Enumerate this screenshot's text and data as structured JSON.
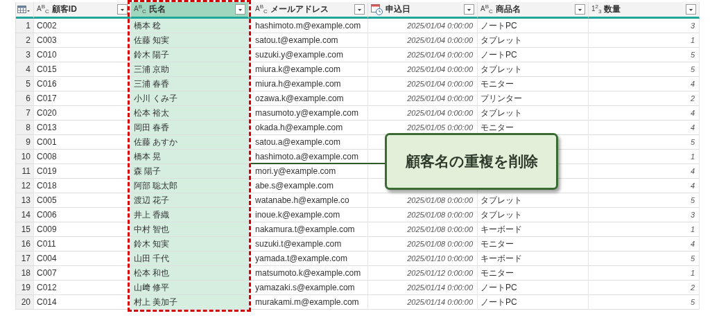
{
  "table": {
    "columns": [
      {
        "label": "顧客ID",
        "kind": "text",
        "type_label": "A$^{B}$$_{C}$",
        "selected": false
      },
      {
        "label": "氏名",
        "kind": "text",
        "type_label": "A$^{B}$$_{C}$",
        "selected": true
      },
      {
        "label": "メールアドレス",
        "kind": "text",
        "type_label": "A$^{B}$$_{C}$",
        "selected": false
      },
      {
        "label": "申込日",
        "kind": "date",
        "selected": false
      },
      {
        "label": "商品名",
        "kind": "text",
        "type_label": "A$^{B}$$_{C}$",
        "selected": false
      },
      {
        "label": "数量",
        "kind": "number",
        "type_label": "1$^{2}$$_{3}$",
        "selected": false
      }
    ],
    "rows": [
      {
        "number": "1",
        "cells": [
          "C002",
          "橋本 稔",
          "hashimoto.m@example.com",
          "2025/01/04 0:00:00",
          "ノートPC",
          "3"
        ]
      },
      {
        "number": "2",
        "cells": [
          "C003",
          "佐藤 知実",
          "satou.t@example.com",
          "2025/01/04 0:00:00",
          "タブレット",
          "1"
        ]
      },
      {
        "number": "3",
        "cells": [
          "C010",
          "鈴木 陽子",
          "suzuki.y@example.com",
          "2025/01/04 0:00:00",
          "ノートPC",
          "5"
        ]
      },
      {
        "number": "4",
        "cells": [
          "C015",
          "三浦 京助",
          "miura.k@example.com",
          "2025/01/04 0:00:00",
          "タブレット",
          "5"
        ]
      },
      {
        "number": "5",
        "cells": [
          "C016",
          "三浦 春香",
          "miura.h@example.com",
          "2025/01/04 0:00:00",
          "モニター",
          "4"
        ]
      },
      {
        "number": "6",
        "cells": [
          "C017",
          "小川 くみ子",
          "ozawa.k@example.com",
          "2025/01/04 0:00:00",
          "プリンター",
          "2"
        ]
      },
      {
        "number": "7",
        "cells": [
          "C020",
          "松本 裕太",
          "masumoto.y@example.com",
          "2025/01/04 0:00:00",
          "タブレット",
          "4"
        ]
      },
      {
        "number": "8",
        "cells": [
          "C013",
          "岡田 春香",
          "okada.h@example.com",
          "2025/01/05 0:00:00",
          "モニター",
          "4"
        ]
      },
      {
        "number": "9",
        "cells": [
          "C001",
          "佐藤 あすか",
          "satou.a@example.com",
          null,
          null,
          "5"
        ]
      },
      {
        "number": "10",
        "cells": [
          "C008",
          "橋本 晃",
          "hashimoto.a@example.com",
          null,
          null,
          "1"
        ]
      },
      {
        "number": "11",
        "cells": [
          "C019",
          "森 陽子",
          "mori.y@example.com",
          null,
          null,
          "4"
        ]
      },
      {
        "number": "12",
        "cells": [
          "C018",
          "阿部 聡太郎",
          "abe.s@example.com",
          null,
          null,
          "4"
        ]
      },
      {
        "number": "13",
        "cells": [
          "C005",
          "渡辺 花子",
          "watanabe.h@example.co",
          "2025/01/08 0:00:00",
          "タブレット",
          "5"
        ]
      },
      {
        "number": "14",
        "cells": [
          "C006",
          "井上 香織",
          "inoue.k@example.com",
          "2025/01/08 0:00:00",
          "タブレット",
          "3"
        ]
      },
      {
        "number": "15",
        "cells": [
          "C009",
          "中村 智也",
          "nakamura.t@example.com",
          "2025/01/08 0:00:00",
          "キーボード",
          "1"
        ]
      },
      {
        "number": "16",
        "cells": [
          "C011",
          "鈴木 知実",
          "suzuki.t@example.com",
          "2025/01/08 0:00:00",
          "モニター",
          "4"
        ]
      },
      {
        "number": "17",
        "cells": [
          "C004",
          "山田 千代",
          "yamada.t@example.com",
          "2025/01/10 0:00:00",
          "キーボード",
          "5"
        ]
      },
      {
        "number": "18",
        "cells": [
          "C007",
          "松本 和也",
          "matsumoto.k@example.com",
          "2025/01/12 0:00:00",
          "モニター",
          "1"
        ]
      },
      {
        "number": "19",
        "cells": [
          "C012",
          "山﨑 修平",
          "yamazaki.s@example.com",
          "2025/01/14 0:00:00",
          "ノートPC",
          "2"
        ]
      },
      {
        "number": "20",
        "cells": [
          "C014",
          "村上 美加子",
          "murakami.m@example.com",
          "2025/01/14 0:00:00",
          "ノートPC",
          "5"
        ]
      }
    ]
  },
  "callout": {
    "text": "顧客名の重複を削除"
  }
}
